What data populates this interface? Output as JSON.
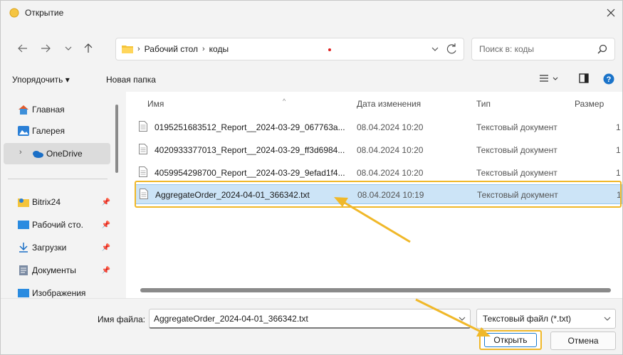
{
  "window": {
    "title": "Открытие"
  },
  "nav": {
    "breadcrumb": [
      "Рабочий стол",
      "коды"
    ],
    "search_placeholder": "Поиск в: коды"
  },
  "toolbar": {
    "organize": "Упорядочить ▾",
    "new_folder": "Новая папка"
  },
  "sidebar": {
    "items": [
      {
        "label": "Главная",
        "icon": "home-icon"
      },
      {
        "label": "Галерея",
        "icon": "gallery-icon"
      },
      {
        "label": "OneDrive",
        "icon": "onedrive-icon"
      },
      {
        "label": "Bitrix24",
        "icon": "bitrix-folder-icon"
      },
      {
        "label": "Рабочий сто.",
        "icon": "desktop-icon"
      },
      {
        "label": "Загрузки",
        "icon": "downloads-icon"
      },
      {
        "label": "Документы",
        "icon": "documents-icon"
      },
      {
        "label": "Изображения",
        "icon": "pictures-icon"
      }
    ]
  },
  "columns": {
    "name": "Имя",
    "date": "Дата изменения",
    "type": "Тип",
    "size": "Размер"
  },
  "files": [
    {
      "name": "0195251683512_Report__2024-03-29_067763a...",
      "date": "08.04.2024 10:20",
      "type": "Текстовый документ",
      "size": "1"
    },
    {
      "name": "4020933377013_Report__2024-03-29_ff3d6984...",
      "date": "08.04.2024 10:20",
      "type": "Текстовый документ",
      "size": "1"
    },
    {
      "name": "4059954298700_Report__2024-03-29_9efad1f4...",
      "date": "08.04.2024 10:20",
      "type": "Текстовый документ",
      "size": "1"
    },
    {
      "name": "AggregateOrder_2024-04-01_366342.txt",
      "date": "08.04.2024 10:19",
      "type": "Текстовый документ",
      "size": "1"
    }
  ],
  "bottom": {
    "filename_label": "Имя файла:",
    "filename_value": "AggregateOrder_2024-04-01_366342.txt",
    "filetype": "Текстовый файл (*.txt)",
    "open": "Открыть",
    "cancel": "Отмена"
  },
  "colors": {
    "accent": "#f0b829",
    "selection": "#cce4f7",
    "primary_border": "#1a7bd1"
  }
}
